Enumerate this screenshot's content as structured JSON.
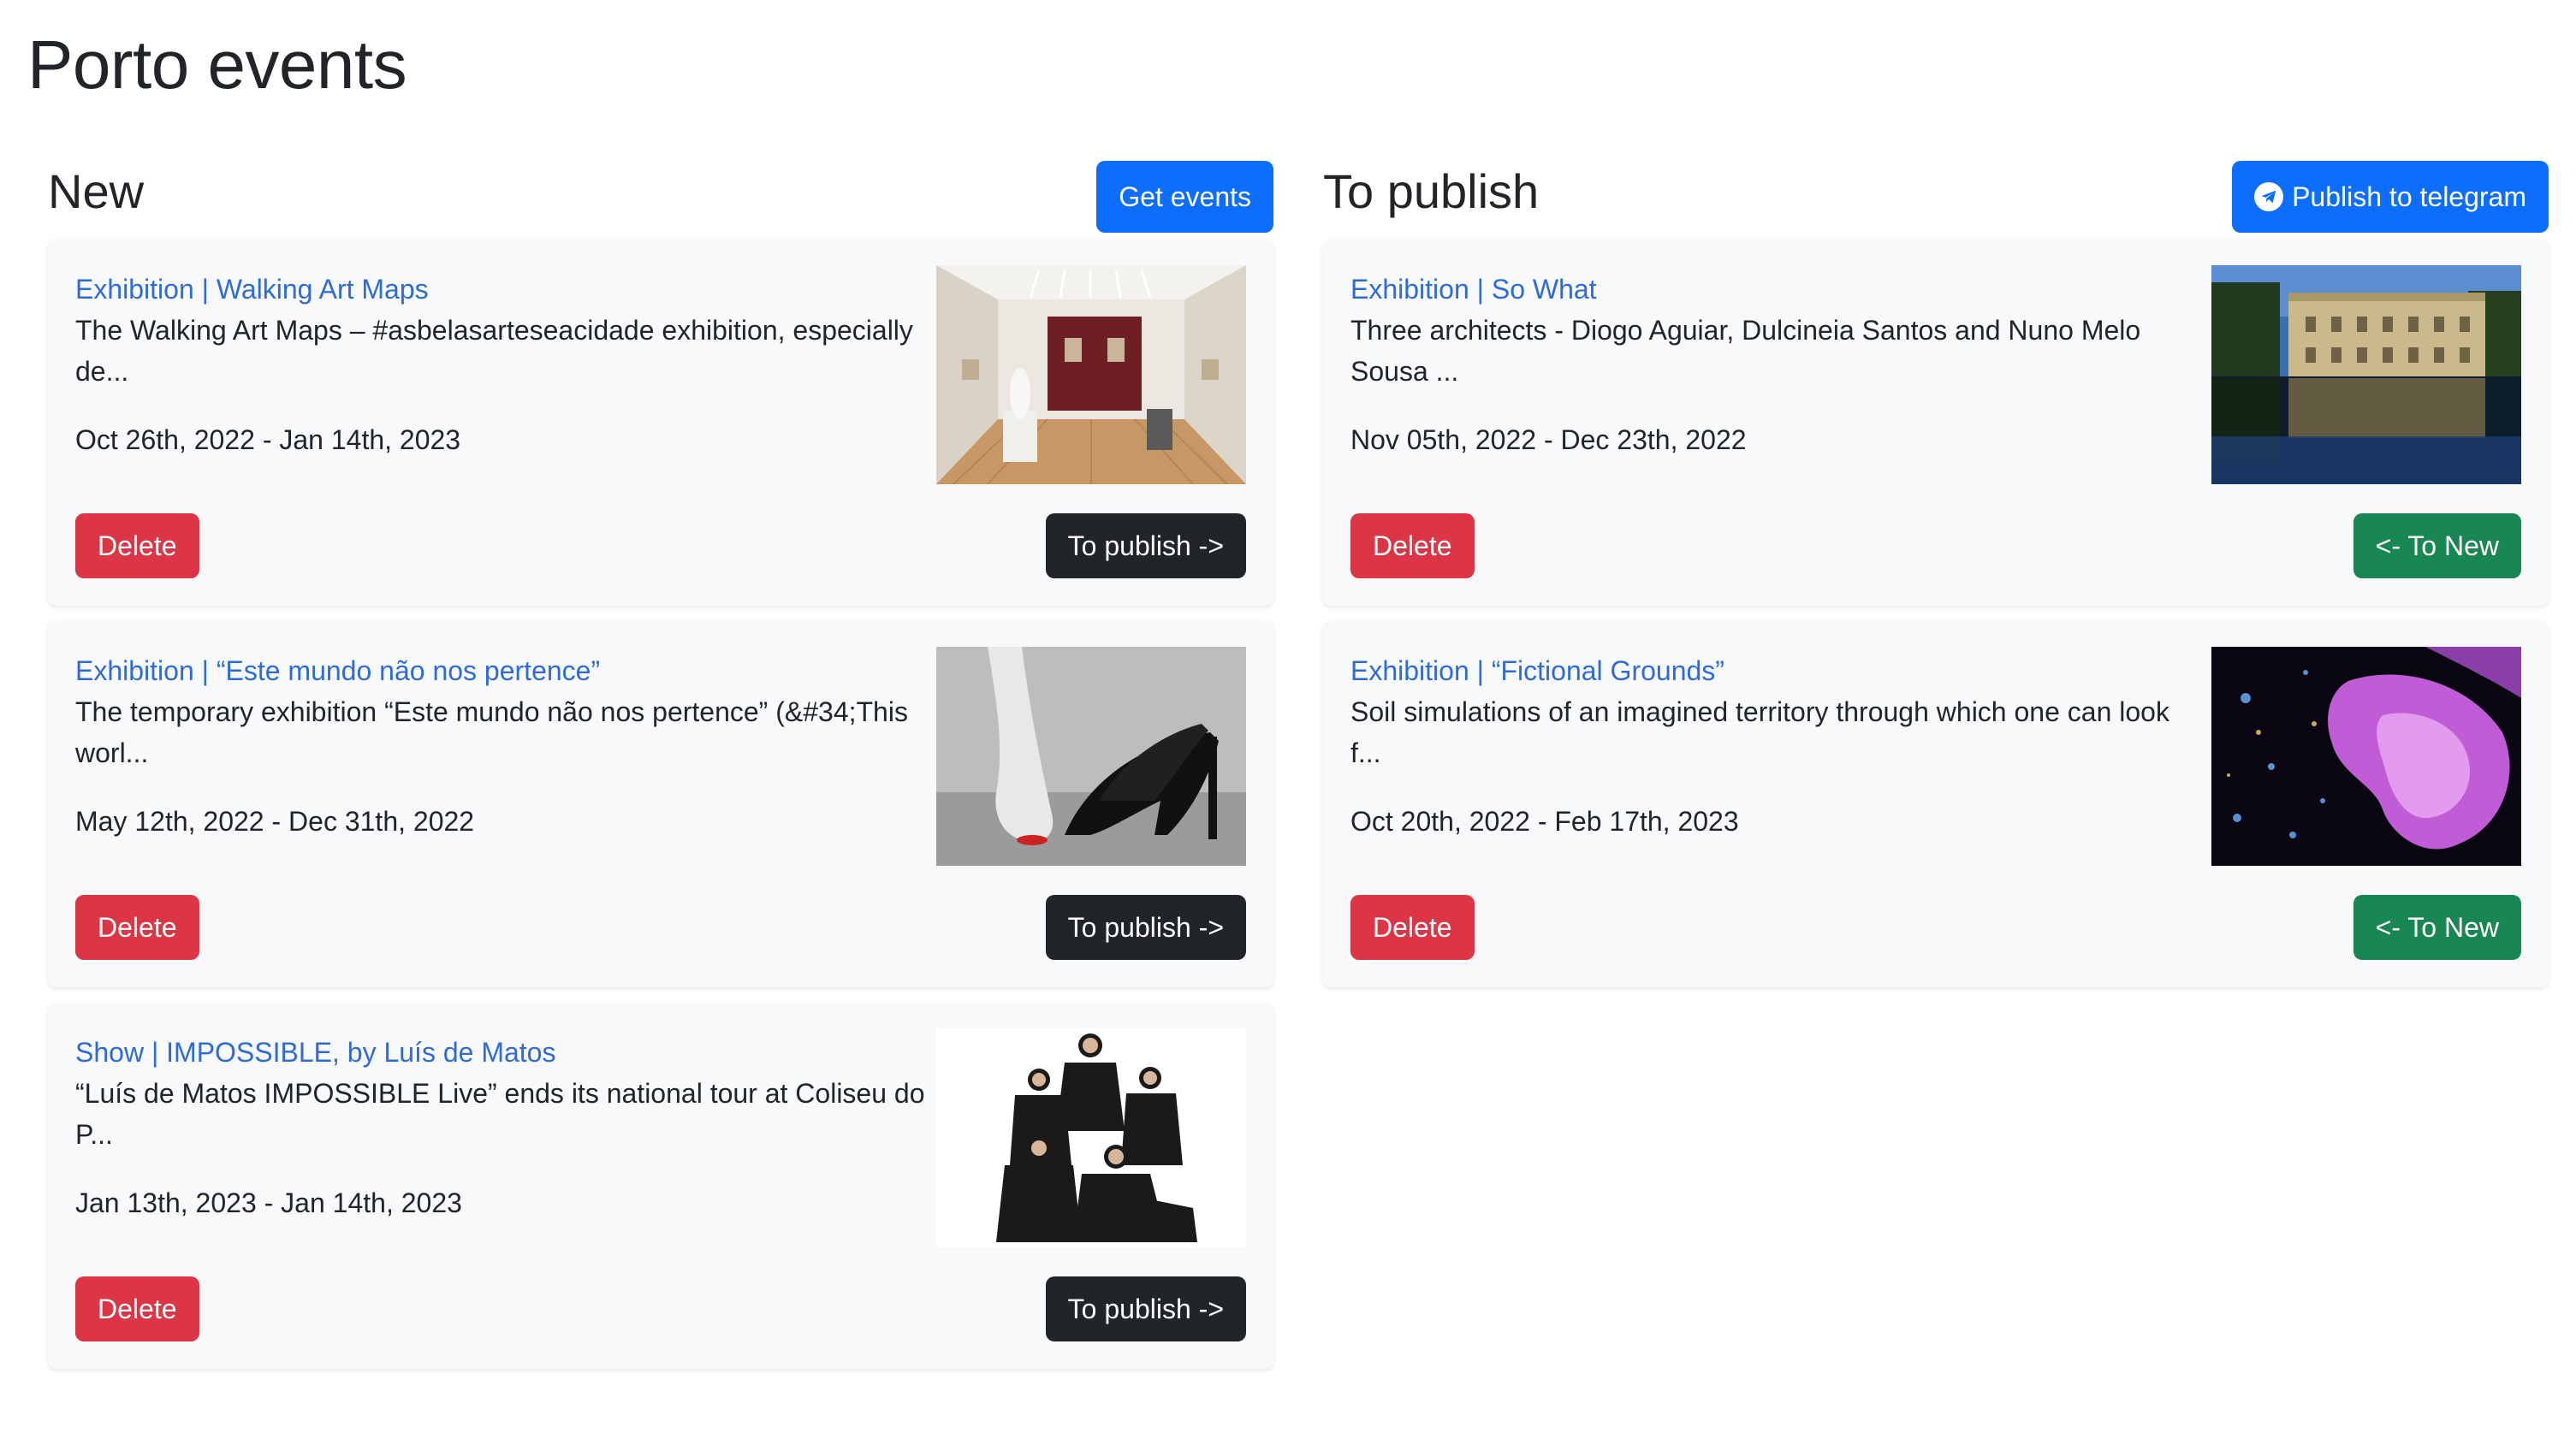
{
  "page": {
    "title": "Porto events"
  },
  "new_column": {
    "heading": "New",
    "get_events_label": "Get events",
    "events": [
      {
        "title": "Exhibition | Walking Art Maps",
        "description": "The Walking Art Maps – #asbelasarteseacidade exhibition, especially de...",
        "dates": "Oct 26th, 2022 - Jan 14th, 2023",
        "delete_label": "Delete",
        "move_label": "To publish ->"
      },
      {
        "title": "Exhibition | “Este mundo não nos pertence”",
        "description": "The temporary exhibition “Este mundo não nos pertence” (&#34;This worl...",
        "dates": "May 12th, 2022 - Dec 31th, 2022",
        "delete_label": "Delete",
        "move_label": "To publish ->"
      },
      {
        "title": "Show | IMPOSSIBLE, by Luís de Matos",
        "description": "“Luís de Matos IMPOSSIBLE Live” ends its national tour at Coliseu do P...",
        "dates": "Jan 13th, 2023 - Jan 14th, 2023",
        "delete_label": "Delete",
        "move_label": "To publish ->"
      }
    ]
  },
  "publish_column": {
    "heading": "To publish",
    "publish_label": "Publish to telegram",
    "events": [
      {
        "title": "Exhibition | So What",
        "description": "Three architects - Diogo Aguiar, Dulcineia Santos and Nuno Melo Sousa ...",
        "dates": "Nov 05th, 2022 - Dec 23th, 2022",
        "delete_label": "Delete",
        "move_label": "<- To New"
      },
      {
        "title": "Exhibition | “Fictional Grounds”",
        "description": "Soil simulations of an imagined territory through which one can look f...",
        "dates": "Oct 20th, 2022 - Feb 17th, 2023",
        "delete_label": "Delete",
        "move_label": "<- To New"
      }
    ]
  },
  "colors": {
    "primary": "#0d6efd",
    "danger": "#dc3545",
    "dark": "#212529",
    "success": "#198754",
    "link": "#2f6bd8",
    "card_bg": "#f8f9fa"
  },
  "icons": {
    "publish_button": "telegram-icon"
  }
}
